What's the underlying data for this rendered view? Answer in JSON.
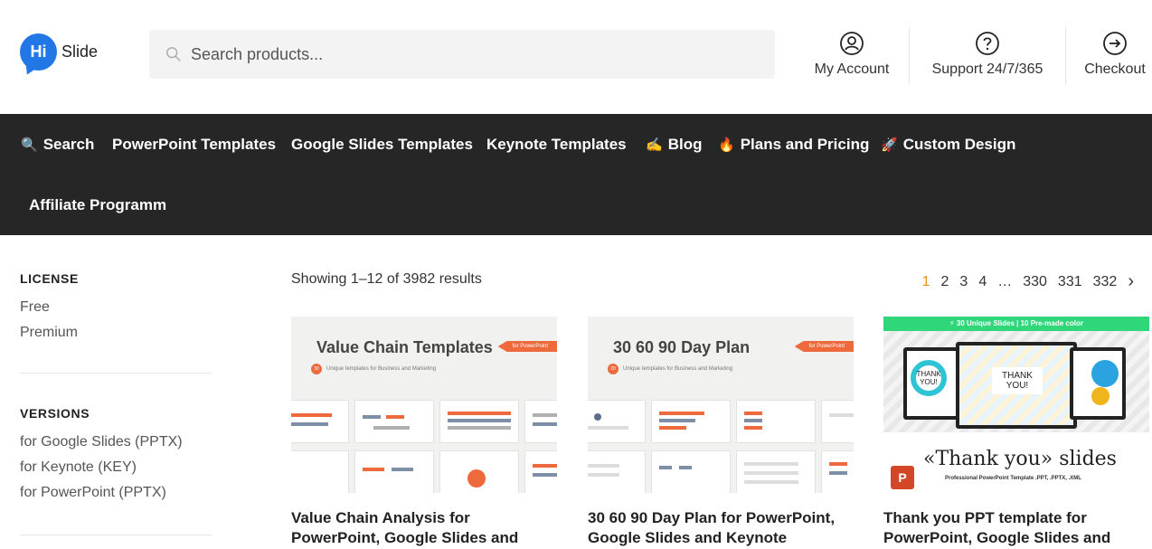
{
  "header": {
    "logo_mark": "Hi",
    "logo_text": "Slide",
    "search_placeholder": "Search products...",
    "account_label": "My Account",
    "support_label": "Support 24/7/365",
    "checkout_label": "Checkout"
  },
  "nav": {
    "items": [
      {
        "emoji": "🔍",
        "label": "Search"
      },
      {
        "emoji": "",
        "label": "PowerPoint Templates"
      },
      {
        "emoji": "",
        "label": "Google Slides Templates"
      },
      {
        "emoji": "",
        "label": "Keynote Templates"
      },
      {
        "emoji": "✍️",
        "label": "Blog"
      },
      {
        "emoji": "🔥",
        "label": "Plans and Pricing"
      },
      {
        "emoji": "🚀",
        "label": "Custom Design"
      },
      {
        "emoji": "",
        "label": "Affiliate Programm"
      }
    ]
  },
  "sidebar": {
    "license_title": "LICENSE",
    "license_items": [
      "Free",
      "Premium"
    ],
    "versions_title": "VERSIONS",
    "version_items": [
      "for Google Slides (PPTX)",
      "for Keynote (KEY)",
      "for PowerPoint (PPTX)"
    ]
  },
  "results": {
    "count_text": "Showing 1–12 of 3982 results",
    "pages": [
      "1",
      "2",
      "3",
      "4",
      "…",
      "330",
      "331",
      "332"
    ],
    "current_page": "1",
    "next_symbol": "›"
  },
  "products": [
    {
      "title": "Value Chain Analysis for PowerPoint, Google Slides and",
      "thumb_heading": "Value Chain Templates",
      "thumb_tag": "for PowerPoint",
      "thumb_count": "30",
      "thumb_sub": "Unique templates for Business and Marketing"
    },
    {
      "title": "30 60 90 Day Plan for PowerPoint, Google Slides and Keynote",
      "thumb_heading": "30 60 90 Day Plan",
      "thumb_tag": "for PowerPoint",
      "thumb_count": "20",
      "thumb_sub": "Unique templates for Business and Marketing"
    },
    {
      "title": "Thank you PPT template for PowerPoint, Google Slides and",
      "thumb_banner": "⚡ 30 Unique Slides | 10 Pre-made color",
      "thumb_screen_text": "THANK YOU!",
      "thumb_headline": "«Thank you» slides",
      "thumb_sub": "Professional PowerPoint Template .PPT, .PPTX, .XML",
      "thumb_icon_letter": "P"
    }
  ],
  "colors": {
    "nav_bg": "#262626",
    "logo_blue": "#2277e6",
    "accent_orange": "#e58d1e",
    "tag_orange": "#ee6a3d",
    "banner_green": "#2fd67a"
  }
}
